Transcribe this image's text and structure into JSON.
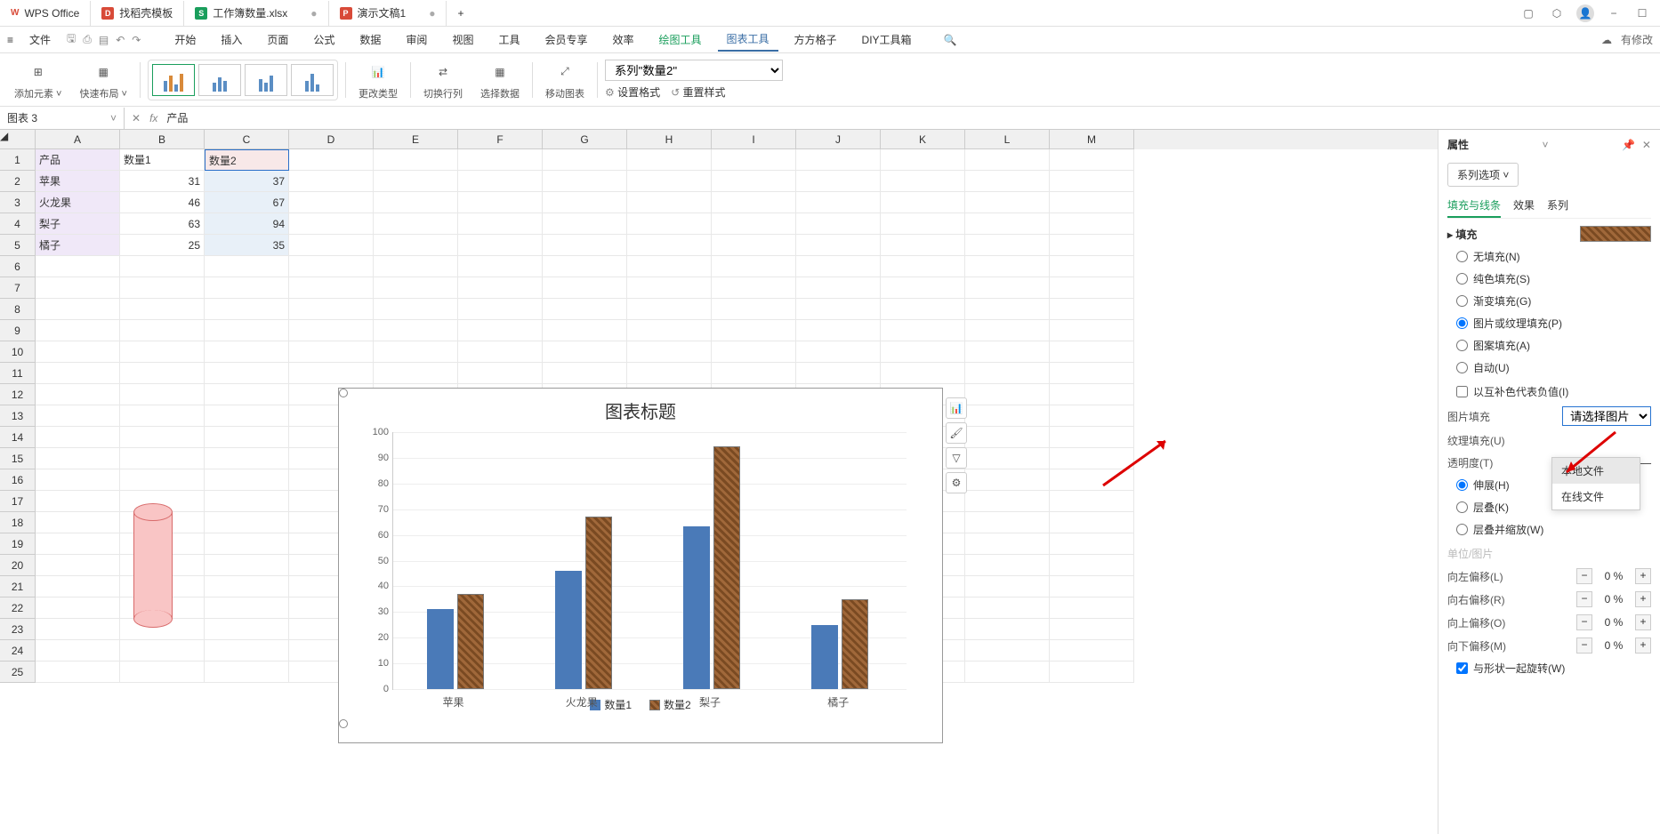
{
  "title_bar": {
    "app_name": "WPS Office",
    "tabs": [
      {
        "icon": "D",
        "icon_color": "#d84a38",
        "label": "找稻壳模板"
      },
      {
        "icon": "S",
        "icon_color": "#1a9e5c",
        "label": "工作簿数量.xlsx",
        "active": true,
        "dirty": "●"
      },
      {
        "icon": "P",
        "icon_color": "#d84a38",
        "label": "演示文稿1",
        "dirty": "●"
      }
    ],
    "new_tab": "+"
  },
  "menu": {
    "file": "文件",
    "items": [
      "开始",
      "插入",
      "页面",
      "公式",
      "数据",
      "审阅",
      "视图",
      "工具",
      "会员专享",
      "效率",
      "绘图工具",
      "图表工具",
      "方方格子",
      "DIY工具箱"
    ],
    "right_label": "有修改"
  },
  "toolbar": {
    "add_element": "添加元素",
    "quick_layout": "快速布局",
    "change_type": "更改类型",
    "switch_rc": "切换行列",
    "select_data": "选择数据",
    "move_chart": "移动图表",
    "set_format": "设置格式",
    "reset_style": "重置样式",
    "series_select": "系列\"数量2\""
  },
  "formula_bar": {
    "name_box": "图表 3",
    "fx": "fx",
    "value": "产品"
  },
  "spreadsheet": {
    "cols": [
      "A",
      "B",
      "C",
      "D",
      "E",
      "F",
      "G",
      "H",
      "I",
      "J",
      "K",
      "L",
      "M"
    ],
    "data": [
      [
        "产品",
        "数量1",
        "数量2"
      ],
      [
        "苹果",
        "31",
        "37"
      ],
      [
        "火龙果",
        "46",
        "67"
      ],
      [
        "梨子",
        "63",
        "94"
      ],
      [
        "橘子",
        "25",
        "35"
      ]
    ]
  },
  "chart_data": {
    "type": "bar",
    "title": "图表标题",
    "categories": [
      "苹果",
      "火龙果",
      "梨子",
      "橘子"
    ],
    "series": [
      {
        "name": "数量1",
        "values": [
          31,
          46,
          63,
          25
        ],
        "color": "#4a7ab8"
      },
      {
        "name": "数量2",
        "values": [
          37,
          67,
          94,
          35
        ],
        "color": "texture"
      }
    ],
    "ylim": [
      0,
      100
    ],
    "ytick": 10,
    "xlabel": "",
    "ylabel": ""
  },
  "props": {
    "title": "属性",
    "series_options": "系列选项",
    "tabs": [
      "填充与线条",
      "效果",
      "系列"
    ],
    "section_fill": "填充",
    "fill_options": {
      "none": "无填充(N)",
      "solid": "纯色填充(S)",
      "gradient": "渐变填充(G)",
      "picture": "图片或纹理填充(P)",
      "pattern": "图案填充(A)",
      "auto": "自动(U)"
    },
    "invert_neg": "以互补色代表负值(I)",
    "picture_fill_label": "图片填充",
    "picture_fill_placeholder": "请选择图片",
    "dropdown": {
      "local": "本地文件",
      "online": "在线文件"
    },
    "texture_fill_label": "纹理填充(U)",
    "opacity_label": "透明度(T)",
    "stretch": "伸展(H)",
    "stack": "层叠(K)",
    "stack_scale": "层叠并缩放(W)",
    "unit_label": "单位/图片",
    "offset_left": "向左偏移(L)",
    "offset_right": "向右偏移(R)",
    "offset_top": "向上偏移(O)",
    "offset_bottom": "向下偏移(M)",
    "offset_val": "0 %",
    "rotate_with_shape": "与形状一起旋转(W)"
  }
}
